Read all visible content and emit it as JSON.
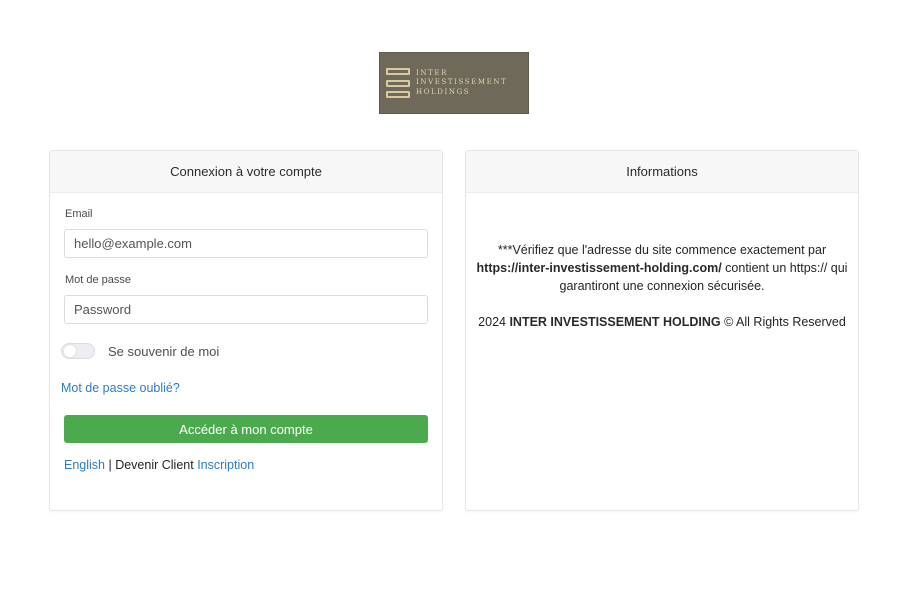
{
  "logo": {
    "lines": [
      "INTER",
      "INVESTISSEMENT",
      "HOLDINGS"
    ],
    "colors": {
      "background": "#6e6958",
      "text": "#e0d4b0"
    }
  },
  "login_card": {
    "title": "Connexion à votre compte",
    "email_label": "Email",
    "email_placeholder": "hello@example.com",
    "password_label": "Mot de passe",
    "password_placeholder": "Password",
    "remember_label": "Se souvenir de moi",
    "remember_checked": false,
    "forgot_link": "Mot de passe oublié?",
    "submit_label": "Accéder à mon compte",
    "footer": {
      "english_link": "English",
      "separator": " | ",
      "become_client_text": "Devenir Client ",
      "signup_link": "Inscription"
    }
  },
  "info_card": {
    "title": "Informations",
    "warning_prefix": "***Vérifiez que l'adresse du site commence exactement par",
    "site_url": "https://inter-investissement-holding.com/",
    "warning_suffix": " contient un https:// qui garantiront une connexion sécurisée.",
    "copyright_year": "2024 ",
    "company_name": "INTER INVESTISSEMENT HOLDING",
    "copyright_suffix": " © All Rights Reserved"
  },
  "colors": {
    "accent_green": "#4caa4e",
    "link_blue": "#2c7cc7"
  }
}
